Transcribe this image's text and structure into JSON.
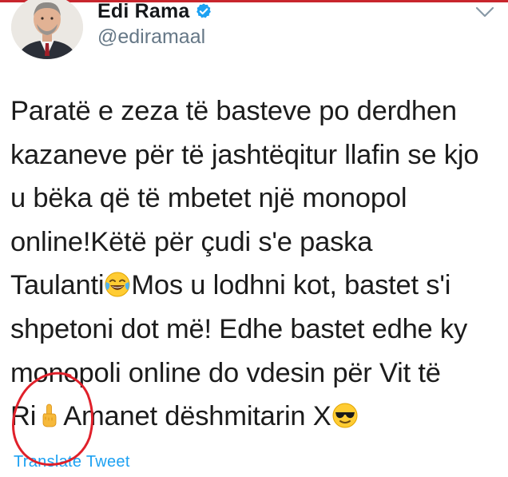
{
  "author": {
    "display_name": "Edi Rama",
    "handle": "@ediramaal",
    "verified": true
  },
  "icons": {
    "verified": "verified-badge-icon",
    "caret": "chevron-down-icon",
    "laugh": "face-with-tears-of-joy-icon",
    "finger": "middle-finger-icon",
    "sunglasses": "smiling-face-with-sunglasses-icon"
  },
  "tweet": {
    "lines": [
      "Paratë e zeza të basteve po derdhen",
      "kazaneve për të jashtëqitur llafin se kjo",
      "u bëka që të mbetet një monopol",
      "online!Këtë për çudi s'e paska",
      "Taulanti",
      "Mos u lodhni kot, bastet s'i",
      "shpetoni dot më! Edhe bastet edhe ky",
      "monopoli online do vdesin për Vit të",
      "Ri",
      "Amanet dëshmitarin X"
    ]
  },
  "translate_label": "Translate Tweet",
  "colors": {
    "accent": "#1da1f2",
    "handle": "#657786",
    "annotation": "#e0202a",
    "top_bar": "#c8262d"
  }
}
